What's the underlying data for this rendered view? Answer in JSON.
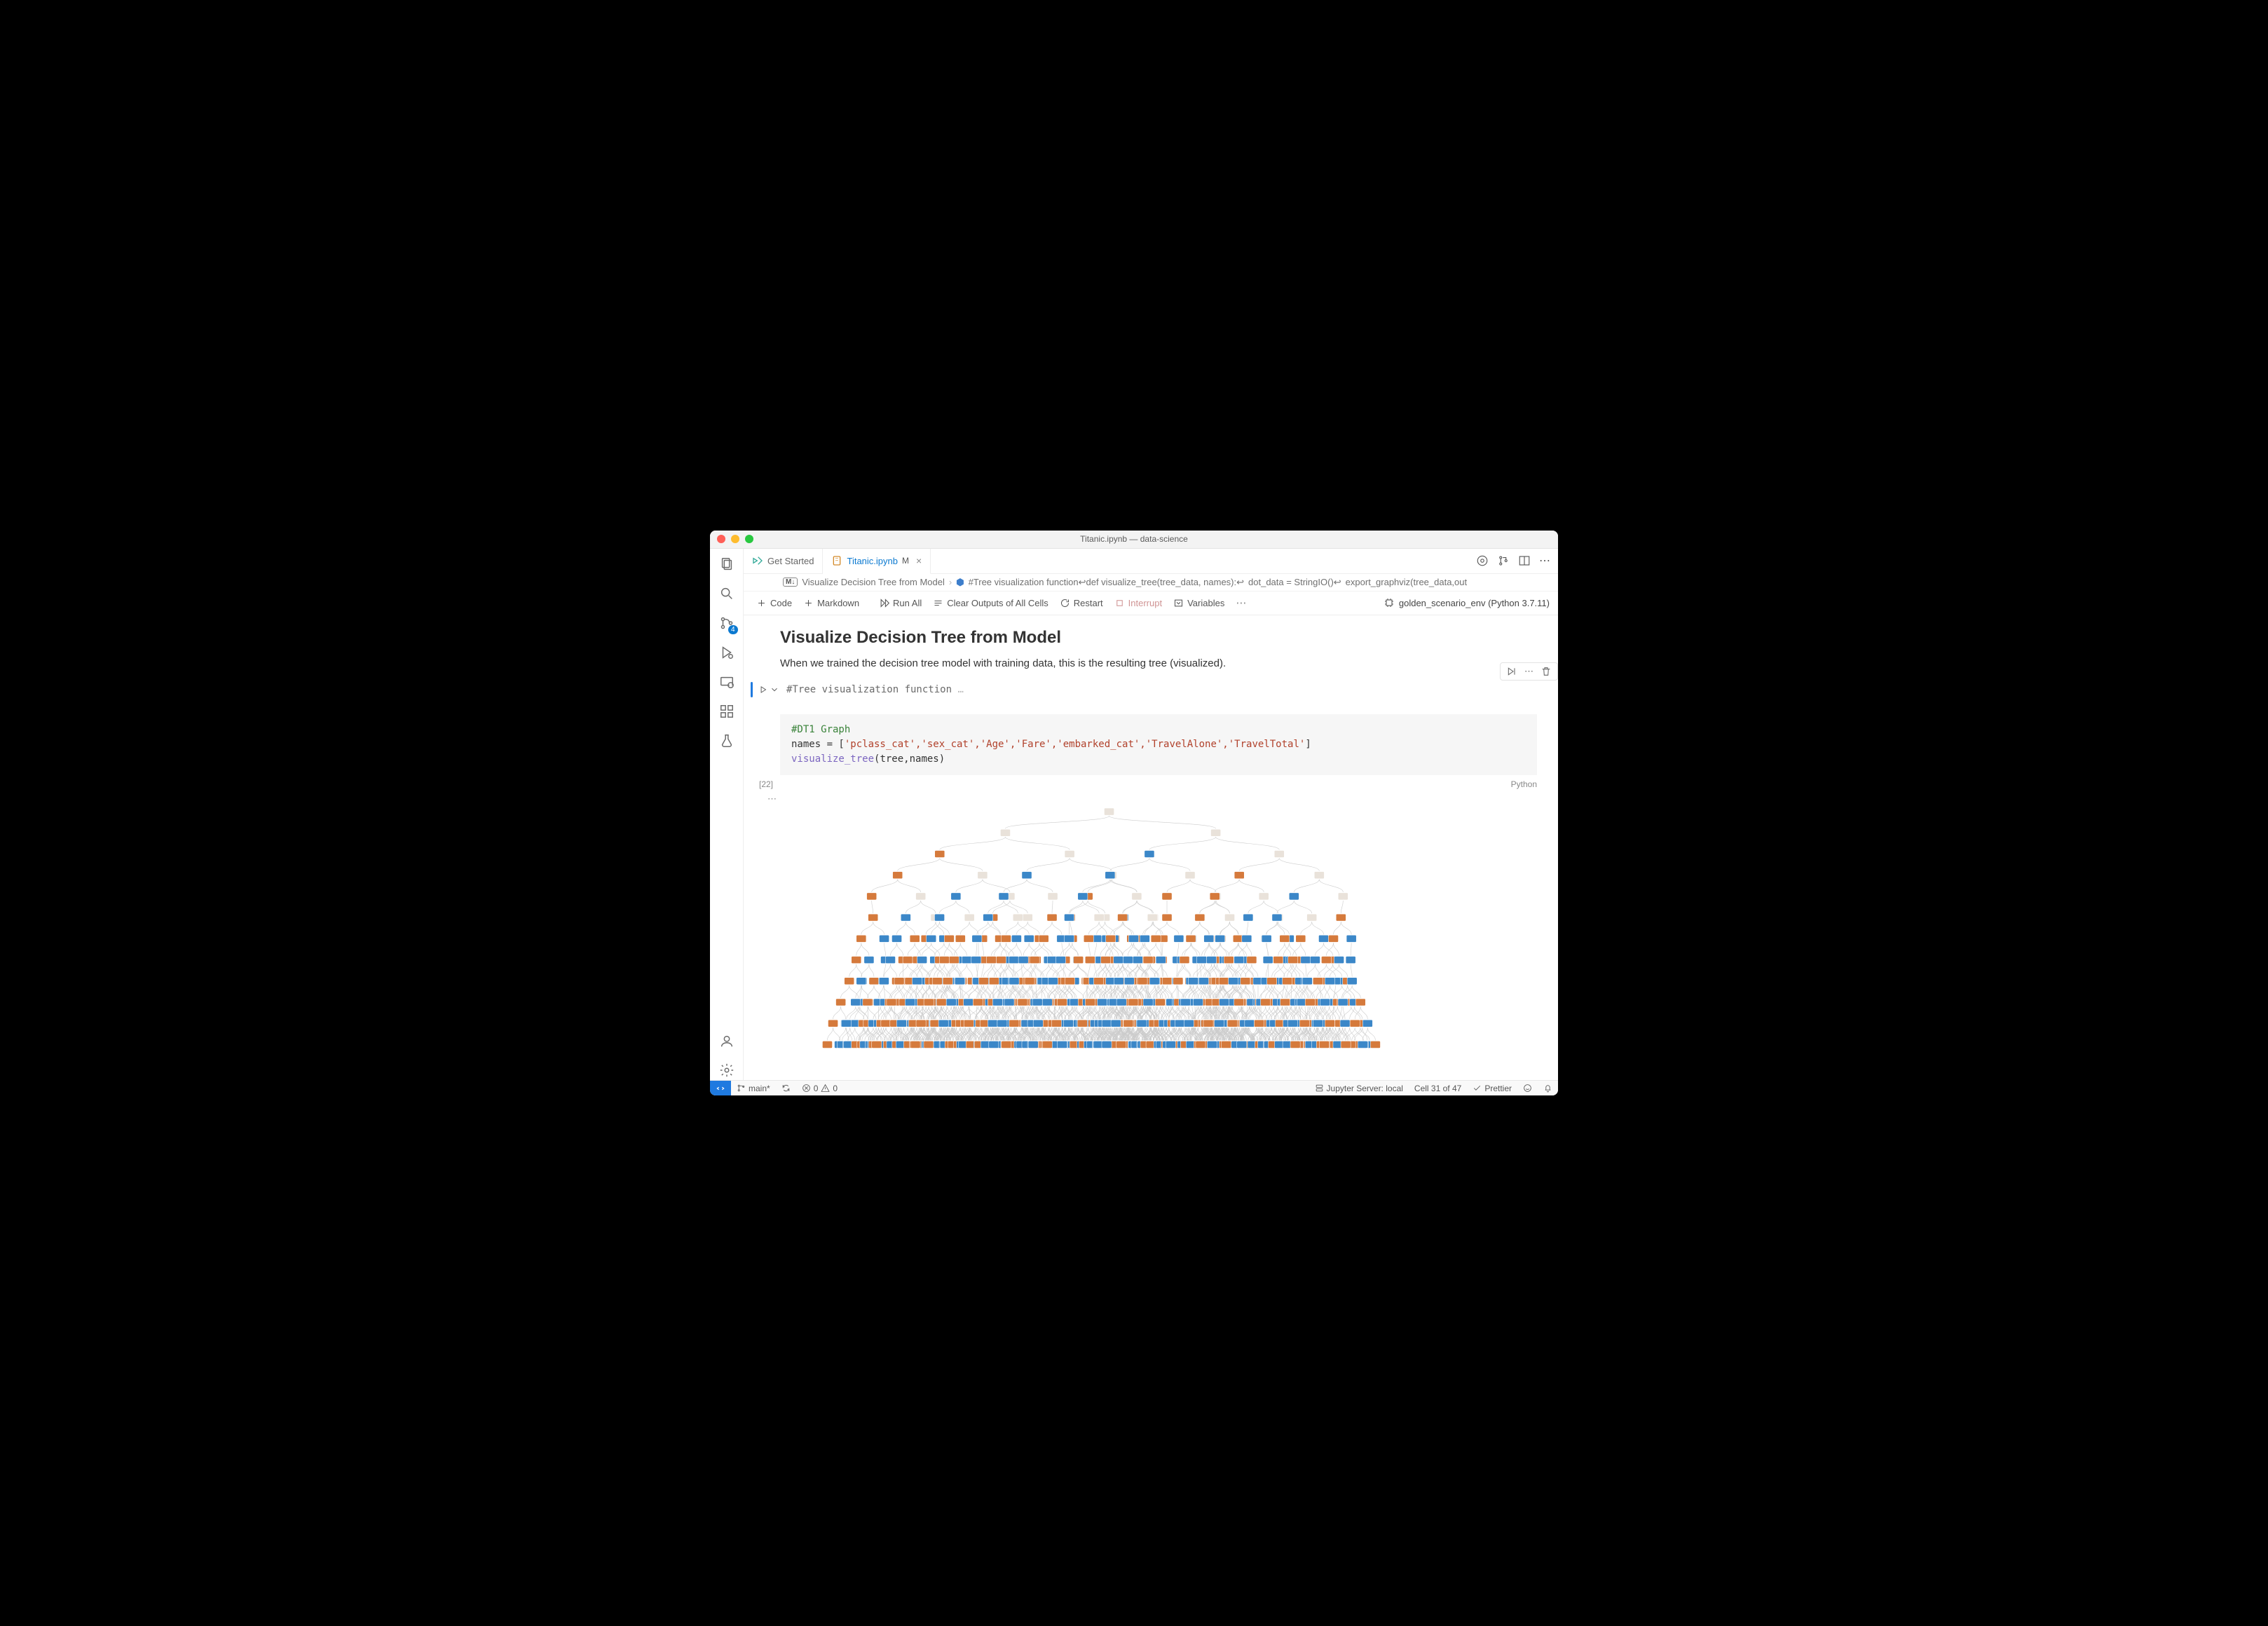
{
  "window": {
    "title": "Titanic.ipynb — data-science"
  },
  "tabs": [
    {
      "label": "Get Started",
      "icon": "vscode",
      "active": false
    },
    {
      "label": "Titanic.ipynb",
      "icon": "notebook",
      "active": true,
      "modified": "M"
    }
  ],
  "breadcrumbs": {
    "tag": "M↓",
    "section": "Visualize Decision Tree from Model",
    "func": "#Tree visualization function↩def visualize_tree(tree_data, names):↩",
    "rest1": "dot_data = StringIO()↩",
    "rest2": "export_graphviz(tree_data,out"
  },
  "toolbar": {
    "code": "Code",
    "markdown": "Markdown",
    "run_all": "Run All",
    "clear": "Clear Outputs of All Cells",
    "restart": "Restart",
    "interrupt": "Interrupt",
    "variables": "Variables",
    "kernel": "golden_scenario_env (Python 3.7.11)"
  },
  "activitybar": {
    "scm_badge": "4"
  },
  "notebook": {
    "title": "Visualize Decision Tree from Model",
    "paragraph": "When we trained the decision tree model with training data, this is the resulting tree (visualized).",
    "collapsed_summary": "#Tree visualization function",
    "exec_count": "[22]",
    "lang": "Python",
    "code_comment": "#DT1 Graph",
    "code_line2a": "names = [",
    "code_line2b": "'pclass_cat','sex_cat','Age','Fare','embarked_cat','TravelAlone','TravelTotal'",
    "code_line2c": "]",
    "code_line3_fn": "visualize_tree",
    "code_line3_args": "(tree,names)"
  },
  "statusbar": {
    "branch": "main*",
    "errors": "0",
    "warnings": "0",
    "jupyter": "Jupyter Server: local",
    "cell": "Cell 31 of 47",
    "prettier": "Prettier"
  },
  "tree_graph": {
    "description": "Rendered decision-tree graphviz output: ~12 levels, branching fan with mixed blue (class 0) and orange (class 1) leaf nodes.",
    "depth": 12,
    "class_colors": {
      "0": "#3b87c8",
      "1": "#d57a3c",
      "mixed": "#e9e2da"
    }
  }
}
